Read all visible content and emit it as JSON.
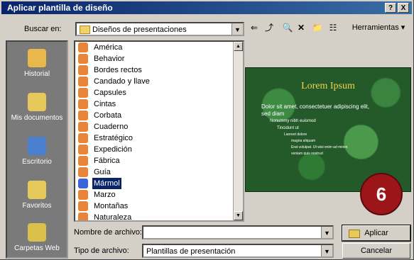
{
  "dialog": {
    "title": "Aplicar plantilla de diseño",
    "help_label": "?",
    "close_label": "X"
  },
  "lookin": {
    "label": "Buscar en:",
    "value": "Diseños de presentaciones"
  },
  "toolbar": {
    "back": "⇐",
    "up": "⤴",
    "search": "🔍",
    "delete": "✕",
    "newfolder": "📁",
    "views": "☷",
    "tools": "Herramientas ▾"
  },
  "places": [
    {
      "label": "Historial"
    },
    {
      "label": "Mis documentos"
    },
    {
      "label": "Escritorio"
    },
    {
      "label": "Favoritos"
    },
    {
      "label": "Carpetas Web"
    }
  ],
  "files": [
    "América",
    "Behavior",
    "Bordes rectos",
    "Candado y llave",
    "Capsules",
    "Cintas",
    "Corbata",
    "Cuaderno",
    "Estratégico",
    "Expedición",
    "Fábrica",
    "Guía",
    "Mármol",
    "Marzo",
    "Montañas",
    "Naturaleza"
  ],
  "selected_index": 12,
  "preview": {
    "title": "Lorem Ipsum",
    "lines": [
      "Dolor sit amet, consectetuer adipiscing elit,",
      "sed diam",
      "Nonummy nibh euismod",
      "Tincidunt ut",
      "Laoreet dolore",
      "magna aliquam",
      "Erat volutpat. Ut wisi enim ad minim",
      "veniam quis nostrud"
    ]
  },
  "badge": "6",
  "filename": {
    "label": "Nombre de archivo:",
    "value": ""
  },
  "filetype": {
    "label": "Tipo de archivo:",
    "value": "Plantillas de presentación"
  },
  "buttons": {
    "apply": "Aplicar",
    "cancel": "Cancelar"
  },
  "colors": {
    "titlebar": "#0a246a",
    "selection": "#0a246a",
    "badge": "#9c1518"
  }
}
